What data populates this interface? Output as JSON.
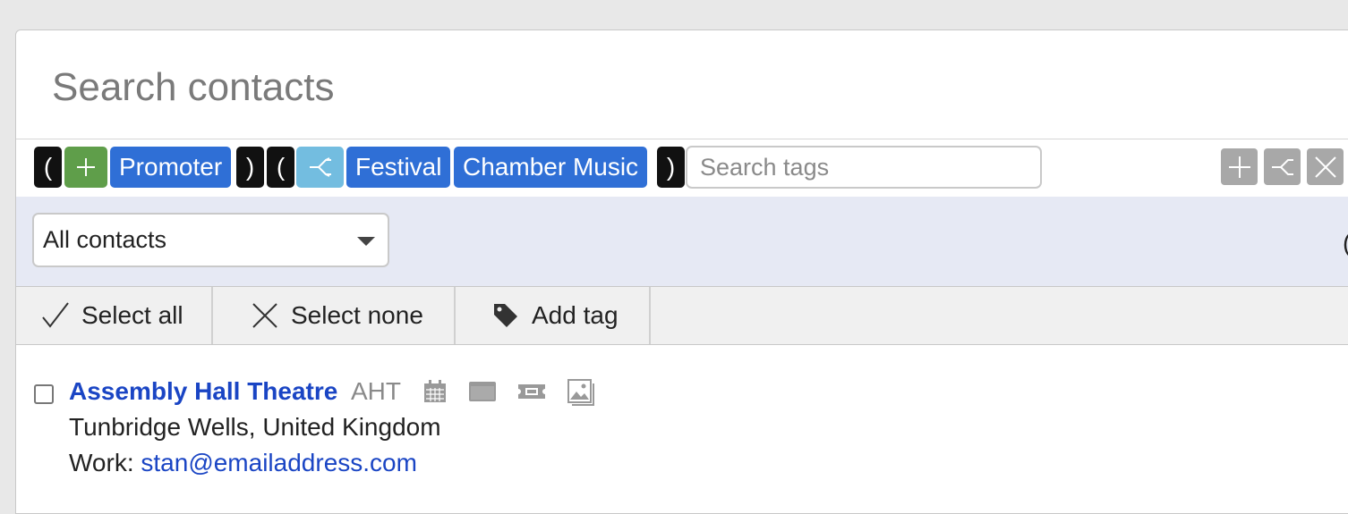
{
  "search": {
    "title": "Search contacts"
  },
  "tags": {
    "open_paren_1": "(",
    "close_paren_1": ")",
    "open_paren_2": "(",
    "close_paren_2": ")",
    "group1_operator_icon": "plus-icon",
    "group2_operator_icon": "branch-icon",
    "group1_tags": [
      "Promoter"
    ],
    "group2_tags": [
      "Festival",
      "Chamber Music"
    ],
    "search_placeholder": "Search tags",
    "controls": [
      "plus-icon",
      "branch-icon",
      "close-icon"
    ]
  },
  "filter": {
    "selected": "All contacts",
    "edge_glyph": "("
  },
  "actions": {
    "select_all": "Select all",
    "select_none": "Select none",
    "add_tag": "Add tag"
  },
  "contacts": [
    {
      "name": "Assembly Hall Theatre",
      "abbr": "AHT",
      "icons": [
        "calendar-icon",
        "window-icon",
        "ticket-icon",
        "images-icon"
      ],
      "location": "Tunbridge Wells, United Kingdom",
      "work_label": "Work:",
      "email": "stan@emailaddress.com"
    }
  ],
  "colors": {
    "paren": "#111111",
    "op_add": "#5f9e4a",
    "op_or": "#73bde0",
    "tag": "#2f6fd6",
    "link": "#1a45c4",
    "filter_bg": "#e6e9f4"
  }
}
